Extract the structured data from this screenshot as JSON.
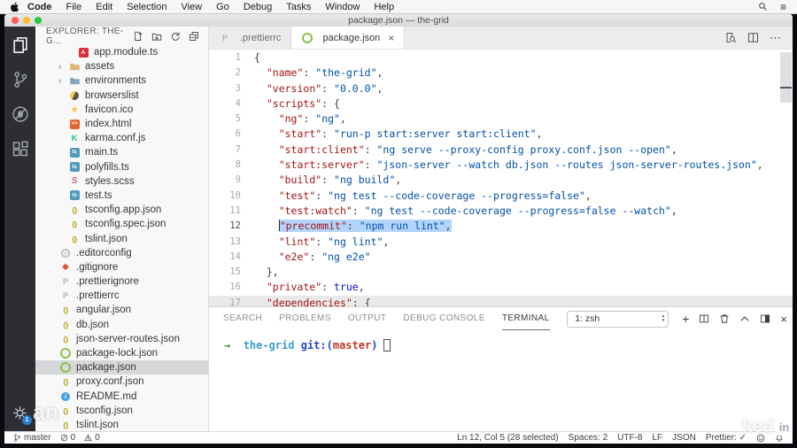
{
  "menu_bar": {
    "app_name": "Code",
    "items": [
      "File",
      "Edit",
      "Selection",
      "View",
      "Go",
      "Debug",
      "Tasks",
      "Window",
      "Help"
    ],
    "right_icons": [
      "spotlight-search-icon",
      "menubar-list-icon"
    ]
  },
  "title_bar": {
    "title": "package.json — the-grid"
  },
  "activity_bar": {
    "items": [
      {
        "name": "explorer-icon",
        "active": true
      },
      {
        "name": "source-control-icon",
        "active": false
      },
      {
        "name": "debug-icon",
        "active": false
      },
      {
        "name": "extensions-icon",
        "active": false
      }
    ],
    "settings": {
      "name": "settings-gear-icon",
      "badge": "1"
    }
  },
  "explorer": {
    "header": "EXPLORER: THE-G...",
    "actions": [
      "new-file-icon",
      "new-folder-icon",
      "refresh-explorer-icon",
      "collapse-folders-icon"
    ],
    "files": [
      {
        "label": "app.module.ts",
        "icon": "angular",
        "level": 3
      },
      {
        "label": "assets",
        "icon": "folder",
        "level": 2,
        "folder": true
      },
      {
        "label": "environments",
        "icon": "folder-env",
        "level": 2,
        "folder": true
      },
      {
        "label": "browserslist",
        "icon": "browserslist",
        "level": 2
      },
      {
        "label": "favicon.ico",
        "icon": "favicon",
        "level": 2
      },
      {
        "label": "index.html",
        "icon": "html",
        "level": 2
      },
      {
        "label": "karma.conf.js",
        "icon": "karma",
        "level": 2
      },
      {
        "label": "main.ts",
        "icon": "typescript",
        "level": 2
      },
      {
        "label": "polyfills.ts",
        "icon": "typescript",
        "level": 2
      },
      {
        "label": "styles.scss",
        "icon": "sass",
        "level": 2
      },
      {
        "label": "test.ts",
        "icon": "typescript",
        "level": 2
      },
      {
        "label": "tsconfig.app.json",
        "icon": "json",
        "level": 2
      },
      {
        "label": "tsconfig.spec.json",
        "icon": "json",
        "level": 2
      },
      {
        "label": "tslint.json",
        "icon": "json",
        "level": 2
      },
      {
        "label": ".editorconfig",
        "icon": "editorconfig",
        "level": 1
      },
      {
        "label": ".gitignore",
        "icon": "git",
        "level": 1
      },
      {
        "label": ".prettierignore",
        "icon": "prettier",
        "level": 1
      },
      {
        "label": ".prettierrc",
        "icon": "prettier",
        "level": 1
      },
      {
        "label": "angular.json",
        "icon": "json",
        "level": 1
      },
      {
        "label": "db.json",
        "icon": "json",
        "level": 1
      },
      {
        "label": "json-server-routes.json",
        "icon": "json",
        "level": 1
      },
      {
        "label": "package-lock.json",
        "icon": "npm",
        "level": 1
      },
      {
        "label": "package.json",
        "icon": "npm",
        "level": 1,
        "selected": true
      },
      {
        "label": "proxy.conf.json",
        "icon": "json",
        "level": 1
      },
      {
        "label": "README.md",
        "icon": "readme",
        "level": 1
      },
      {
        "label": "tsconfig.json",
        "icon": "json",
        "level": 1
      },
      {
        "label": "tslint.json",
        "icon": "json",
        "level": 1
      }
    ]
  },
  "editor": {
    "tabs": [
      {
        "label": ".prettierrc",
        "icon": "prettier",
        "active": false
      },
      {
        "label": "package.json",
        "icon": "npm",
        "active": true,
        "close_label": "×"
      }
    ],
    "actions": [
      "open-preview-icon",
      "split-editor-icon",
      "more-actions-icon"
    ],
    "lines": [
      {
        "n": 1,
        "tokens": [
          [
            "p",
            "{"
          ]
        ]
      },
      {
        "n": 2,
        "tokens": [
          [
            "w",
            "  "
          ],
          [
            "k",
            "\"name\""
          ],
          [
            "p",
            ": "
          ],
          [
            "s",
            "\"the-grid\""
          ],
          [
            "p",
            ","
          ]
        ]
      },
      {
        "n": 3,
        "tokens": [
          [
            "w",
            "  "
          ],
          [
            "k",
            "\"version\""
          ],
          [
            "p",
            ": "
          ],
          [
            "s",
            "\"0.0.0\""
          ],
          [
            "p",
            ","
          ]
        ]
      },
      {
        "n": 4,
        "tokens": [
          [
            "w",
            "  "
          ],
          [
            "k",
            "\"scripts\""
          ],
          [
            "p",
            ": {"
          ]
        ]
      },
      {
        "n": 5,
        "tokens": [
          [
            "w",
            "    "
          ],
          [
            "k",
            "\"ng\""
          ],
          [
            "p",
            ": "
          ],
          [
            "s",
            "\"ng\""
          ],
          [
            "p",
            ","
          ]
        ]
      },
      {
        "n": 6,
        "tokens": [
          [
            "w",
            "    "
          ],
          [
            "k",
            "\"start\""
          ],
          [
            "p",
            ": "
          ],
          [
            "s",
            "\"run-p start:server start:client\""
          ],
          [
            "p",
            ","
          ]
        ]
      },
      {
        "n": 7,
        "tokens": [
          [
            "w",
            "    "
          ],
          [
            "k",
            "\"start:client\""
          ],
          [
            "p",
            ": "
          ],
          [
            "s",
            "\"ng serve --proxy-config proxy.conf.json --open\""
          ],
          [
            "p",
            ","
          ]
        ]
      },
      {
        "n": 8,
        "tokens": [
          [
            "w",
            "    "
          ],
          [
            "k",
            "\"start:server\""
          ],
          [
            "p",
            ": "
          ],
          [
            "s",
            "\"json-server --watch db.json --routes json-server-routes.json\""
          ],
          [
            "p",
            ","
          ]
        ]
      },
      {
        "n": 9,
        "tokens": [
          [
            "w",
            "    "
          ],
          [
            "k",
            "\"build\""
          ],
          [
            "p",
            ": "
          ],
          [
            "s",
            "\"ng build\""
          ],
          [
            "p",
            ","
          ]
        ]
      },
      {
        "n": 10,
        "tokens": [
          [
            "w",
            "    "
          ],
          [
            "k",
            "\"test\""
          ],
          [
            "p",
            ": "
          ],
          [
            "s",
            "\"ng test --code-coverage --progress=false\""
          ],
          [
            "p",
            ","
          ]
        ]
      },
      {
        "n": 11,
        "tokens": [
          [
            "w",
            "    "
          ],
          [
            "k",
            "\"test:watch\""
          ],
          [
            "p",
            ": "
          ],
          [
            "s",
            "\"ng test --code-coverage --progress=false --watch\""
          ],
          [
            "p",
            ","
          ]
        ]
      },
      {
        "n": 12,
        "tokens": [
          [
            "w",
            "    "
          ]
        ],
        "selection": [
          [
            "k",
            "\"precommit\""
          ],
          [
            "p",
            ": "
          ],
          [
            "s",
            "\"npm run lint\""
          ],
          [
            "p",
            ","
          ]
        ]
      },
      {
        "n": 13,
        "tokens": [
          [
            "w",
            "    "
          ],
          [
            "k",
            "\"lint\""
          ],
          [
            "p",
            ": "
          ],
          [
            "s",
            "\"ng lint\""
          ],
          [
            "p",
            ","
          ]
        ]
      },
      {
        "n": 14,
        "tokens": [
          [
            "w",
            "    "
          ],
          [
            "k",
            "\"e2e\""
          ],
          [
            "p",
            ": "
          ],
          [
            "s",
            "\"ng e2e\""
          ]
        ]
      },
      {
        "n": 15,
        "tokens": [
          [
            "w",
            "  "
          ],
          [
            "p",
            "},"
          ]
        ]
      },
      {
        "n": 16,
        "tokens": [
          [
            "w",
            "  "
          ],
          [
            "k",
            "\"private\""
          ],
          [
            "p",
            ": "
          ],
          [
            "b",
            "true"
          ],
          [
            "p",
            ","
          ]
        ]
      },
      {
        "n": 17,
        "dim": true,
        "tokens": [
          [
            "w",
            "  "
          ],
          [
            "k",
            "\"dependencies\""
          ],
          [
            "p",
            ": {"
          ]
        ]
      }
    ]
  },
  "panel": {
    "tabs": [
      "SEARCH",
      "PROBLEMS",
      "OUTPUT",
      "DEBUG CONSOLE",
      "TERMINAL"
    ],
    "active_tab": "TERMINAL",
    "shell_select": "1: zsh",
    "controls": [
      "add-terminal-icon",
      "split-terminal-icon",
      "kill-terminal-icon",
      "maximize-panel-icon",
      "move-panel-icon",
      "close-panel-icon"
    ],
    "terminal_line": {
      "parts": [
        {
          "style": "arrow",
          "text": "→"
        },
        {
          "style": "cwd",
          "text": "the-grid"
        },
        {
          "style": "git",
          "text": "git:("
        },
        {
          "style": "branch",
          "text": "master"
        },
        {
          "style": "git",
          "text": ")"
        }
      ],
      "cursor": true
    }
  },
  "status_bar": {
    "left": [
      {
        "icon": "git-branch-icon",
        "label": "master"
      },
      {
        "icon": "errors-icon",
        "label": "0"
      },
      {
        "icon": "warnings-icon",
        "label": "0"
      }
    ],
    "right": [
      {
        "label": "Ln 12, Col 5 (28 selected)"
      },
      {
        "label": "Spaces: 2"
      },
      {
        "label": "UTF-8"
      },
      {
        "label": "LF"
      },
      {
        "label": "JSON"
      },
      {
        "label": "Prettier: ✓"
      },
      {
        "icon": "feedback-smiley-icon"
      },
      {
        "icon": "notifications-bell-icon"
      }
    ]
  },
  "watermark": {
    "left": "an",
    "right_text": "ked",
    "right_badge": "in"
  }
}
